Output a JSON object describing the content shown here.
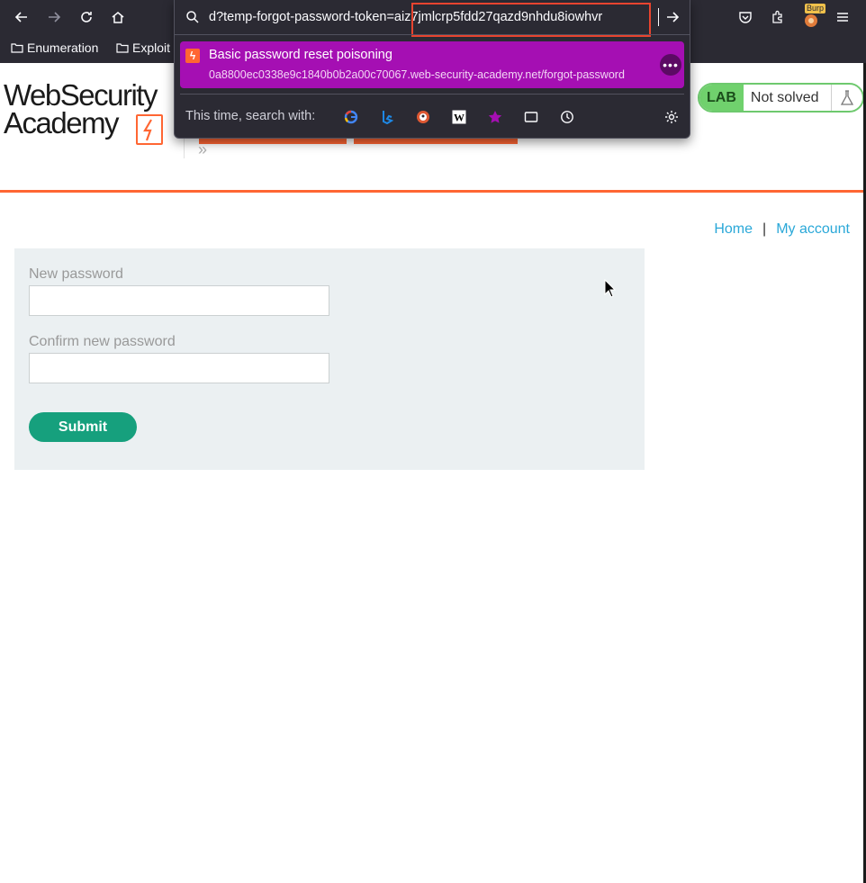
{
  "browser": {
    "bookmarks": [
      {
        "label": "Enumeration"
      },
      {
        "label": "Exploit"
      }
    ],
    "burp_label": "Burp"
  },
  "address_bar": {
    "url_visible": "d?temp-forgot-password-token=aiz7jmlcrp5fdd27qazd9nhdu8iowhvr"
  },
  "suggestion": {
    "title": "Basic password reset poisoning",
    "url": "0a8800ec0338e9c1840b0b2a00c70067.web-security-academy.net/forgot-password"
  },
  "search_with": {
    "label": "This time, search with:",
    "engines": [
      "google-icon",
      "bing-icon",
      "duckduckgo-icon",
      "wikipedia-icon",
      "bookmarks-star-icon",
      "tabs-icon",
      "history-icon"
    ]
  },
  "site": {
    "logo_line1": "WebSecurity",
    "logo_line2": "Academy",
    "lab_label": "LAB",
    "lab_status": "Not solved"
  },
  "nav": {
    "home": "Home",
    "separator": "|",
    "my_account": "My account"
  },
  "form": {
    "new_password_label": "New password",
    "new_password_value": "",
    "confirm_password_label": "Confirm new password",
    "confirm_password_value": "",
    "submit_label": "Submit"
  },
  "colors": {
    "accent": "#ff6633",
    "suggestion_bg": "#a50fb3",
    "submit": "#16a07d",
    "link": "#2aa8d8",
    "lab_green": "#70d16d"
  }
}
